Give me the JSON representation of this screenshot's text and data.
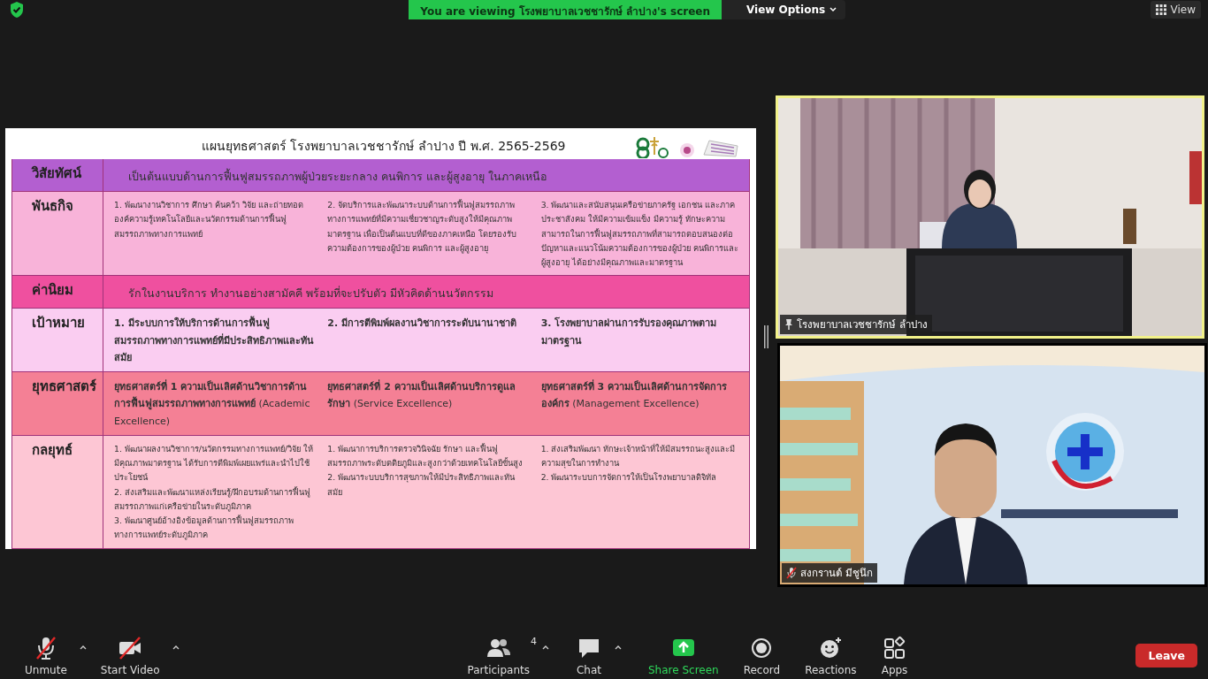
{
  "top_bar": {
    "banner": "You are viewing โรงพยาบาลเวชชารักษ์ ลำปาง's screen",
    "view_options": "View Options",
    "view_button": "View"
  },
  "slide": {
    "title": "แผนยุทธศาสตร์ โรงพยาบาลเวชชารักษ์ ลำปาง ปี พ.ศ. 2565-2569",
    "rows": [
      {
        "kind": "statement",
        "label": "วิสัยทัศน์",
        "color": "#b35fd0",
        "text": "เป็นต้นแบบด้านการฟื้นฟูสมรรถภาพผู้ป่วยระยะกลาง คนพิการ และผู้สูงอายุ ในภาคเหนือ"
      },
      {
        "kind": "fine-columns",
        "label": "พันธกิจ",
        "color": "#f8b3d9",
        "columns": [
          [
            "1. พัฒนางานวิชาการ ศึกษา ค้นคว้า วิจัย และถ่ายทอดองค์ความรู้เทคโนโลยีและนวัตกรรมด้านการฟื้นฟูสมรรถภาพทางการแพทย์"
          ],
          [
            "2. จัดบริการและพัฒนาระบบด้านการฟื้นฟูสมรรถภาพทางการแพทย์ที่มีความเชี่ยวชาญระดับสูงให้มีคุณภาพมาตรฐาน เพื่อเป็นต้นแบบที่ดีของภาคเหนือ โดยรองรับความต้องการของผู้ป่วย คนพิการ และผู้สูงอายุ"
          ],
          [
            "3. พัฒนาและสนับสนุนเครือข่ายภาครัฐ เอกชน และภาคประชาสังคม ให้มีความเข้มแข็ง มีความรู้ ทักษะความสามารถในการฟื้นฟูสมรรถภาพที่สามารถตอบสนองต่อปัญหาและแนวโน้มความต้องการของผู้ป่วย คนพิการและผู้สูงอายุ ได้อย่างมีคุณภาพและมาตรฐาน"
          ]
        ]
      },
      {
        "kind": "statement",
        "label": "ค่านิยม",
        "color": "#ef509f",
        "text": "รักในงานบริการ ทำงานอย่างสามัคคี พร้อมที่จะปรับตัว มีหัวคิดด้านนวัตกรรม"
      },
      {
        "kind": "columns",
        "label": "เป้าหมาย",
        "color": "#facdf1",
        "columns": [
          [
            "1. มีระบบการให้บริการด้านการฟื้นฟูสมรรถภาพทางการแพทย์ที่มีประสิทธิภาพและทันสมัย"
          ],
          [
            "2. มีการตีพิมพ์ผลงานวิชาการระดับนานาชาติ"
          ],
          [
            "3. โรงพยาบาลผ่านการรับรองคุณภาพตามมาตรฐาน"
          ]
        ]
      },
      {
        "kind": "columns",
        "label": "ยุทธศาสตร์",
        "color": "#f48095",
        "columns": [
          [
            "**ยุทธศาสตร์ที่ 1 ความเป็นเลิศด้านวิชาการด้านการฟื้นฟูสมรรถภาพทางการแพทย์** (Academic Excellence)"
          ],
          [
            "**ยุทธศาสตร์ที่ 2 ความเป็นเลิศด้านบริการดูแลรักษา** (Service Excellence)"
          ],
          [
            "**ยุทธศาสตร์ที่ 3 ความเป็นเลิศด้านการจัดการองค์กร** (Management Excellence)"
          ]
        ]
      },
      {
        "kind": "fine-columns",
        "label": "กลยุทธ์",
        "color": "#fdc6d4",
        "columns": [
          [
            "1. พัฒนาผลงานวิชาการ/นวัตกรรมทางการแพทย์/วิจัย ให้มีคุณภาพมาตรฐาน ได้รับการตีพิมพ์เผยแพร่และนำไปใช้ประโยชน์",
            "2. ส่งเสริมและพัฒนาแหล่งเรียนรู้/ฝึกอบรมด้านการฟื้นฟูสมรรถภาพแก่เครือข่ายในระดับภูมิภาค",
            "3. พัฒนาศูนย์อ้างอิงข้อมูลด้านการฟื้นฟูสมรรถภาพทางการแพทย์ระดับภูมิภาค"
          ],
          [
            "1. พัฒนาการบริการตรวจวินิจฉัย รักษา และฟื้นฟูสมรรถภาพระดับตติยภูมิและสูงกว่าด้วยเทคโนโลยีขั้นสูง",
            "2. พัฒนาระบบบริการสุขภาพให้มีประสิทธิภาพและทันสมัย"
          ],
          [
            "1. ส่งเสริมพัฒนา ทักษะเจ้าหน้าที่ให้มีสมรรถนะสูงและมีความสุขในการทำงาน",
            "2. พัฒนาระบบการจัดการให้เป็นโรงพยาบาลดิจิทัล"
          ]
        ]
      }
    ]
  },
  "videos": [
    {
      "kind": "pinned",
      "name": "โรงพยาบาลเวชชารักษ์ ลำปาง",
      "active_speaker": true
    },
    {
      "kind": "muted",
      "name": "สงกรานต์ มีชูนึก",
      "active_speaker": false
    }
  ],
  "toolbar": {
    "items": [
      {
        "kind": "mic-muted",
        "label": "Unmute",
        "caret": true
      },
      {
        "kind": "video-off",
        "label": "Start Video",
        "caret": true
      },
      {
        "kind": "participants",
        "label": "Participants",
        "count": "4",
        "caret": true
      },
      {
        "kind": "chat",
        "label": "Chat",
        "caret": true
      },
      {
        "kind": "share",
        "label": "Share Screen",
        "caret": false
      },
      {
        "kind": "record",
        "label": "Record",
        "caret": false
      },
      {
        "kind": "reactions",
        "label": "Reactions",
        "caret": false
      },
      {
        "kind": "apps",
        "label": "Apps",
        "caret": false
      }
    ],
    "leave": "Leave"
  }
}
